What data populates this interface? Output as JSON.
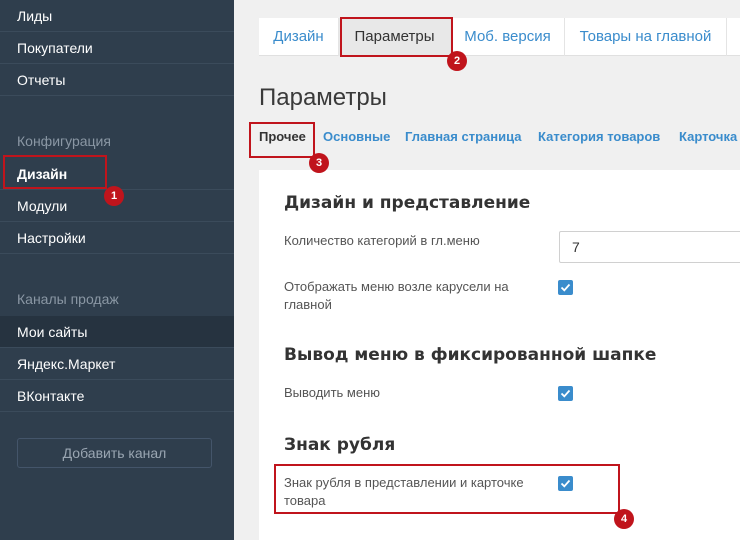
{
  "sidebar": {
    "items_top": [
      "Лиды",
      "Покупатели",
      "Отчеты"
    ],
    "config_heading": "Конфигурация",
    "config_items": [
      "Дизайн",
      "Модули",
      "Настройки"
    ],
    "channels_heading": "Каналы продаж",
    "channel_items": [
      "Мои сайты",
      "Яндекс.Маркет",
      "ВКонтакте"
    ],
    "add_channel": "Добавить канал"
  },
  "tabs": [
    "Дизайн",
    "Параметры",
    "Моб. версия",
    "Товары на главной"
  ],
  "page_title": "Параметры",
  "subnav": [
    "Прочее",
    "Основные",
    "Главная страница",
    "Категория товаров",
    "Карточка"
  ],
  "sections": {
    "design": {
      "title": "Дизайн и представление",
      "categories_label": "Количество категорий в гл.меню",
      "categories_value": "7",
      "show_menu_carousel_label": "Отображать меню возле карусели на главной"
    },
    "fixed_header": {
      "title": "Вывод меню в фиксированной шапке",
      "show_menu_label": "Выводить меню"
    },
    "ruble": {
      "title": "Знак рубля",
      "ruble_sign_label": "Знак рубля в представлении и карточке товара"
    }
  },
  "badges": [
    "1",
    "2",
    "3",
    "4"
  ],
  "colors": {
    "sidebar": "#2f3e4d",
    "accent": "#3a8ccc",
    "highlight": "#c0141c"
  }
}
